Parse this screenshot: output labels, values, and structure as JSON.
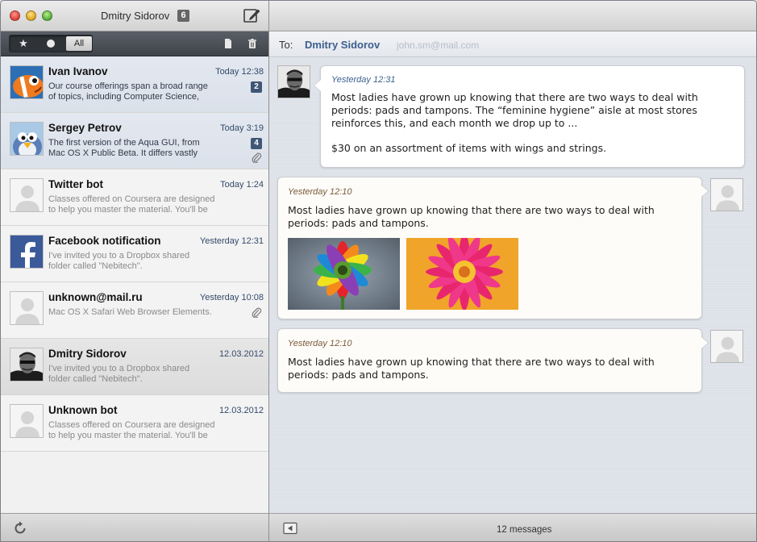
{
  "window": {
    "title": "Dmitry Sidorov",
    "badge": "6"
  },
  "filters": {
    "starred_icon": "star-icon",
    "unread_icon": "dot-icon",
    "all_label": "All",
    "selected": "All"
  },
  "conversations": [
    {
      "sender": "Ivan Ivanov",
      "date": "Today 12:38",
      "preview_1": "Our course offerings span a broad range",
      "preview_2": "of topics, including Computer Science,",
      "count": "2",
      "attachment": false,
      "state": "unread",
      "avatar": "clownfish-avatar"
    },
    {
      "sender": "Sergey Petrov",
      "date": "Today 3:19",
      "preview_1": "The first version of the Aqua GUI, from",
      "preview_2": "Mac OS X Public Beta. It differs vastly",
      "count": "4",
      "attachment": true,
      "state": "unread",
      "avatar": "penguin-avatar"
    },
    {
      "sender": "Twitter bot",
      "date": "Today 1:24",
      "preview_1": "Classes offered on Coursera are designed",
      "preview_2": "to help you master the material. You'll be",
      "count": "",
      "attachment": false,
      "state": "read",
      "avatar": "default-avatar"
    },
    {
      "sender": "Facebook notification",
      "date": "Yesterday 12:31",
      "preview_1": "I've invited you to a Dropbox shared",
      "preview_2": "folder called \"Nebitech\".",
      "count": "",
      "attachment": false,
      "state": "read",
      "avatar": "facebook-avatar"
    },
    {
      "sender": "unknown@mail.ru",
      "date": "Yesterday 10:08",
      "preview_1": "Mac OS X Safari Web Browser Elements.",
      "preview_2": "",
      "count": "",
      "attachment": true,
      "state": "read",
      "avatar": "default-avatar"
    },
    {
      "sender": "Dmitry Sidorov",
      "date": "12.03.2012",
      "preview_1": "I've invited you to a Dropbox shared",
      "preview_2": "folder called \"Nebitech\".",
      "count": "",
      "attachment": false,
      "state": "selected",
      "avatar": "man-sunglasses-avatar"
    },
    {
      "sender": "Unknown bot",
      "date": "12.03.2012",
      "preview_1": "Classes offered on Coursera are designed",
      "preview_2": "to help you master the material. You'll be",
      "count": "",
      "attachment": false,
      "state": "read",
      "avatar": "default-avatar"
    }
  ],
  "header": {
    "to_label": "To:",
    "to_name": "Dmitry Sidorov",
    "to_email": "john.sm@mail.com"
  },
  "messages": [
    {
      "from": "theirs",
      "time": "Yesterday 12:31",
      "text_lines": [
        "Most ladies have grown up knowing that there are two ways to deal with",
        "periods: pads and tampons. The “feminine hygiene” aisle at most stores",
        "reinforces this, and each month we drop up to ...",
        "",
        "$30 on an assortment of items with wings and strings."
      ]
    },
    {
      "from": "mine",
      "time": "Yesterday 12:10",
      "text_lines": [
        "Most ladies have grown up knowing that there are two ways to deal with",
        "periods: pads and tampons."
      ],
      "images": [
        "rainbow-gerbera-photo",
        "pink-orange-flower-photo"
      ]
    },
    {
      "from": "mine",
      "time": "Yesterday 12:10",
      "text_lines": [
        "Most ladies have grown up knowing that there are two ways to deal with",
        "periods: pads and tampons."
      ]
    }
  ],
  "footer": {
    "message_count": "12 messages"
  },
  "colors": {
    "accent_blue": "#3c5f8f",
    "badge_bg": "#3f5676",
    "toolbar_dark": "#45494f"
  }
}
